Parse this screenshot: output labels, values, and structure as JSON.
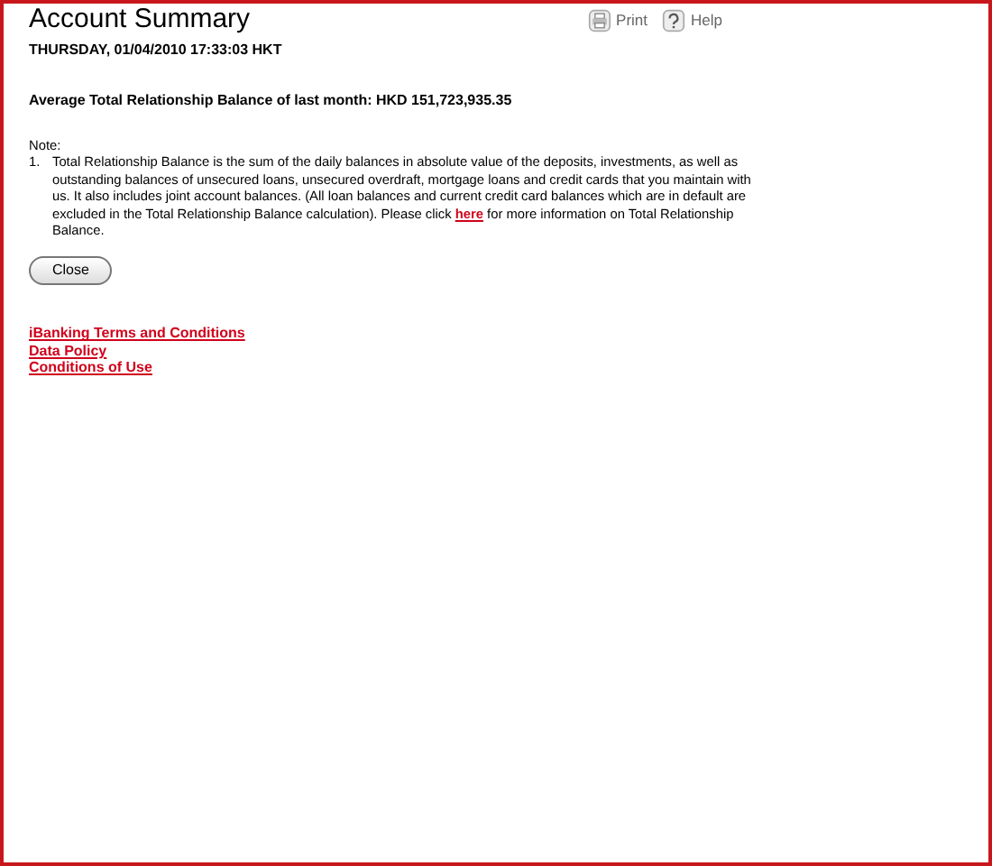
{
  "title": "Account Summary",
  "toolbar": [
    {
      "kind": "print",
      "label": "Print"
    },
    {
      "kind": "help",
      "label": "Help"
    }
  ],
  "timestamp": "THURSDAY, 01/04/2010 17:33:03 HKT",
  "balance": "Average Total Relationship Balance of last month: HKD 151,723,935.35",
  "note": {
    "heading": "Note:",
    "items": [
      {
        "number": "1.",
        "before": "Total Relationship Balance is the sum of the daily balances in absolute value of the deposits, investments, as well as outstanding balances of unsecured loans, unsecured overdraft, mortgage loans and credit cards that you maintain with us. It also includes joint account balances. (All loan balances and current credit card balances which are in default are excluded in the Total Relationship Balance calculation). Please click",
        "link": "here",
        "after": "for more information on Total Relationship Balance."
      }
    ]
  },
  "close_button": "Close",
  "links": [
    "iBanking Terms and Conditions",
    "Data Policy",
    "Conditions of Use"
  ]
}
